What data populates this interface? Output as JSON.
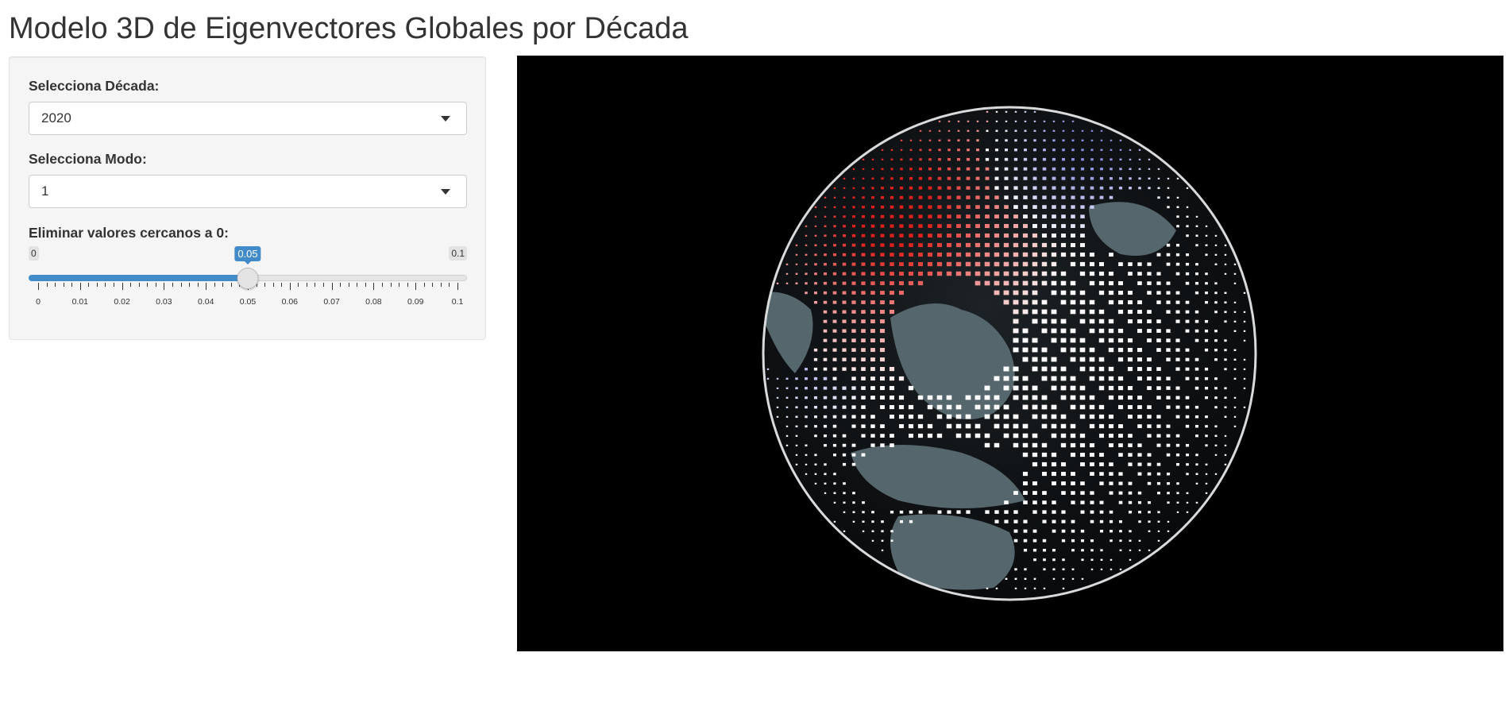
{
  "page": {
    "title": "Modelo 3D de Eigenvectores Globales por Década"
  },
  "sidebar": {
    "decade": {
      "label": "Selecciona Década:",
      "value": "2020"
    },
    "mode": {
      "label": "Selecciona Modo:",
      "value": "1"
    },
    "threshold": {
      "label": "Eliminar valores cercanos a 0:",
      "min_label": "0",
      "max_label": "0.1",
      "value_label": "0.05",
      "value_fraction": 0.5,
      "ticks": [
        "0",
        "0.01",
        "0.02",
        "0.03",
        "0.04",
        "0.05",
        "0.06",
        "0.07",
        "0.08",
        "0.09",
        "0.1"
      ]
    }
  },
  "viewer": {
    "background": "#000000",
    "colors": {
      "positive": "#e0201c",
      "negative": "#8a90e0",
      "neutral": "#ffffff",
      "land": "#55666c"
    }
  }
}
